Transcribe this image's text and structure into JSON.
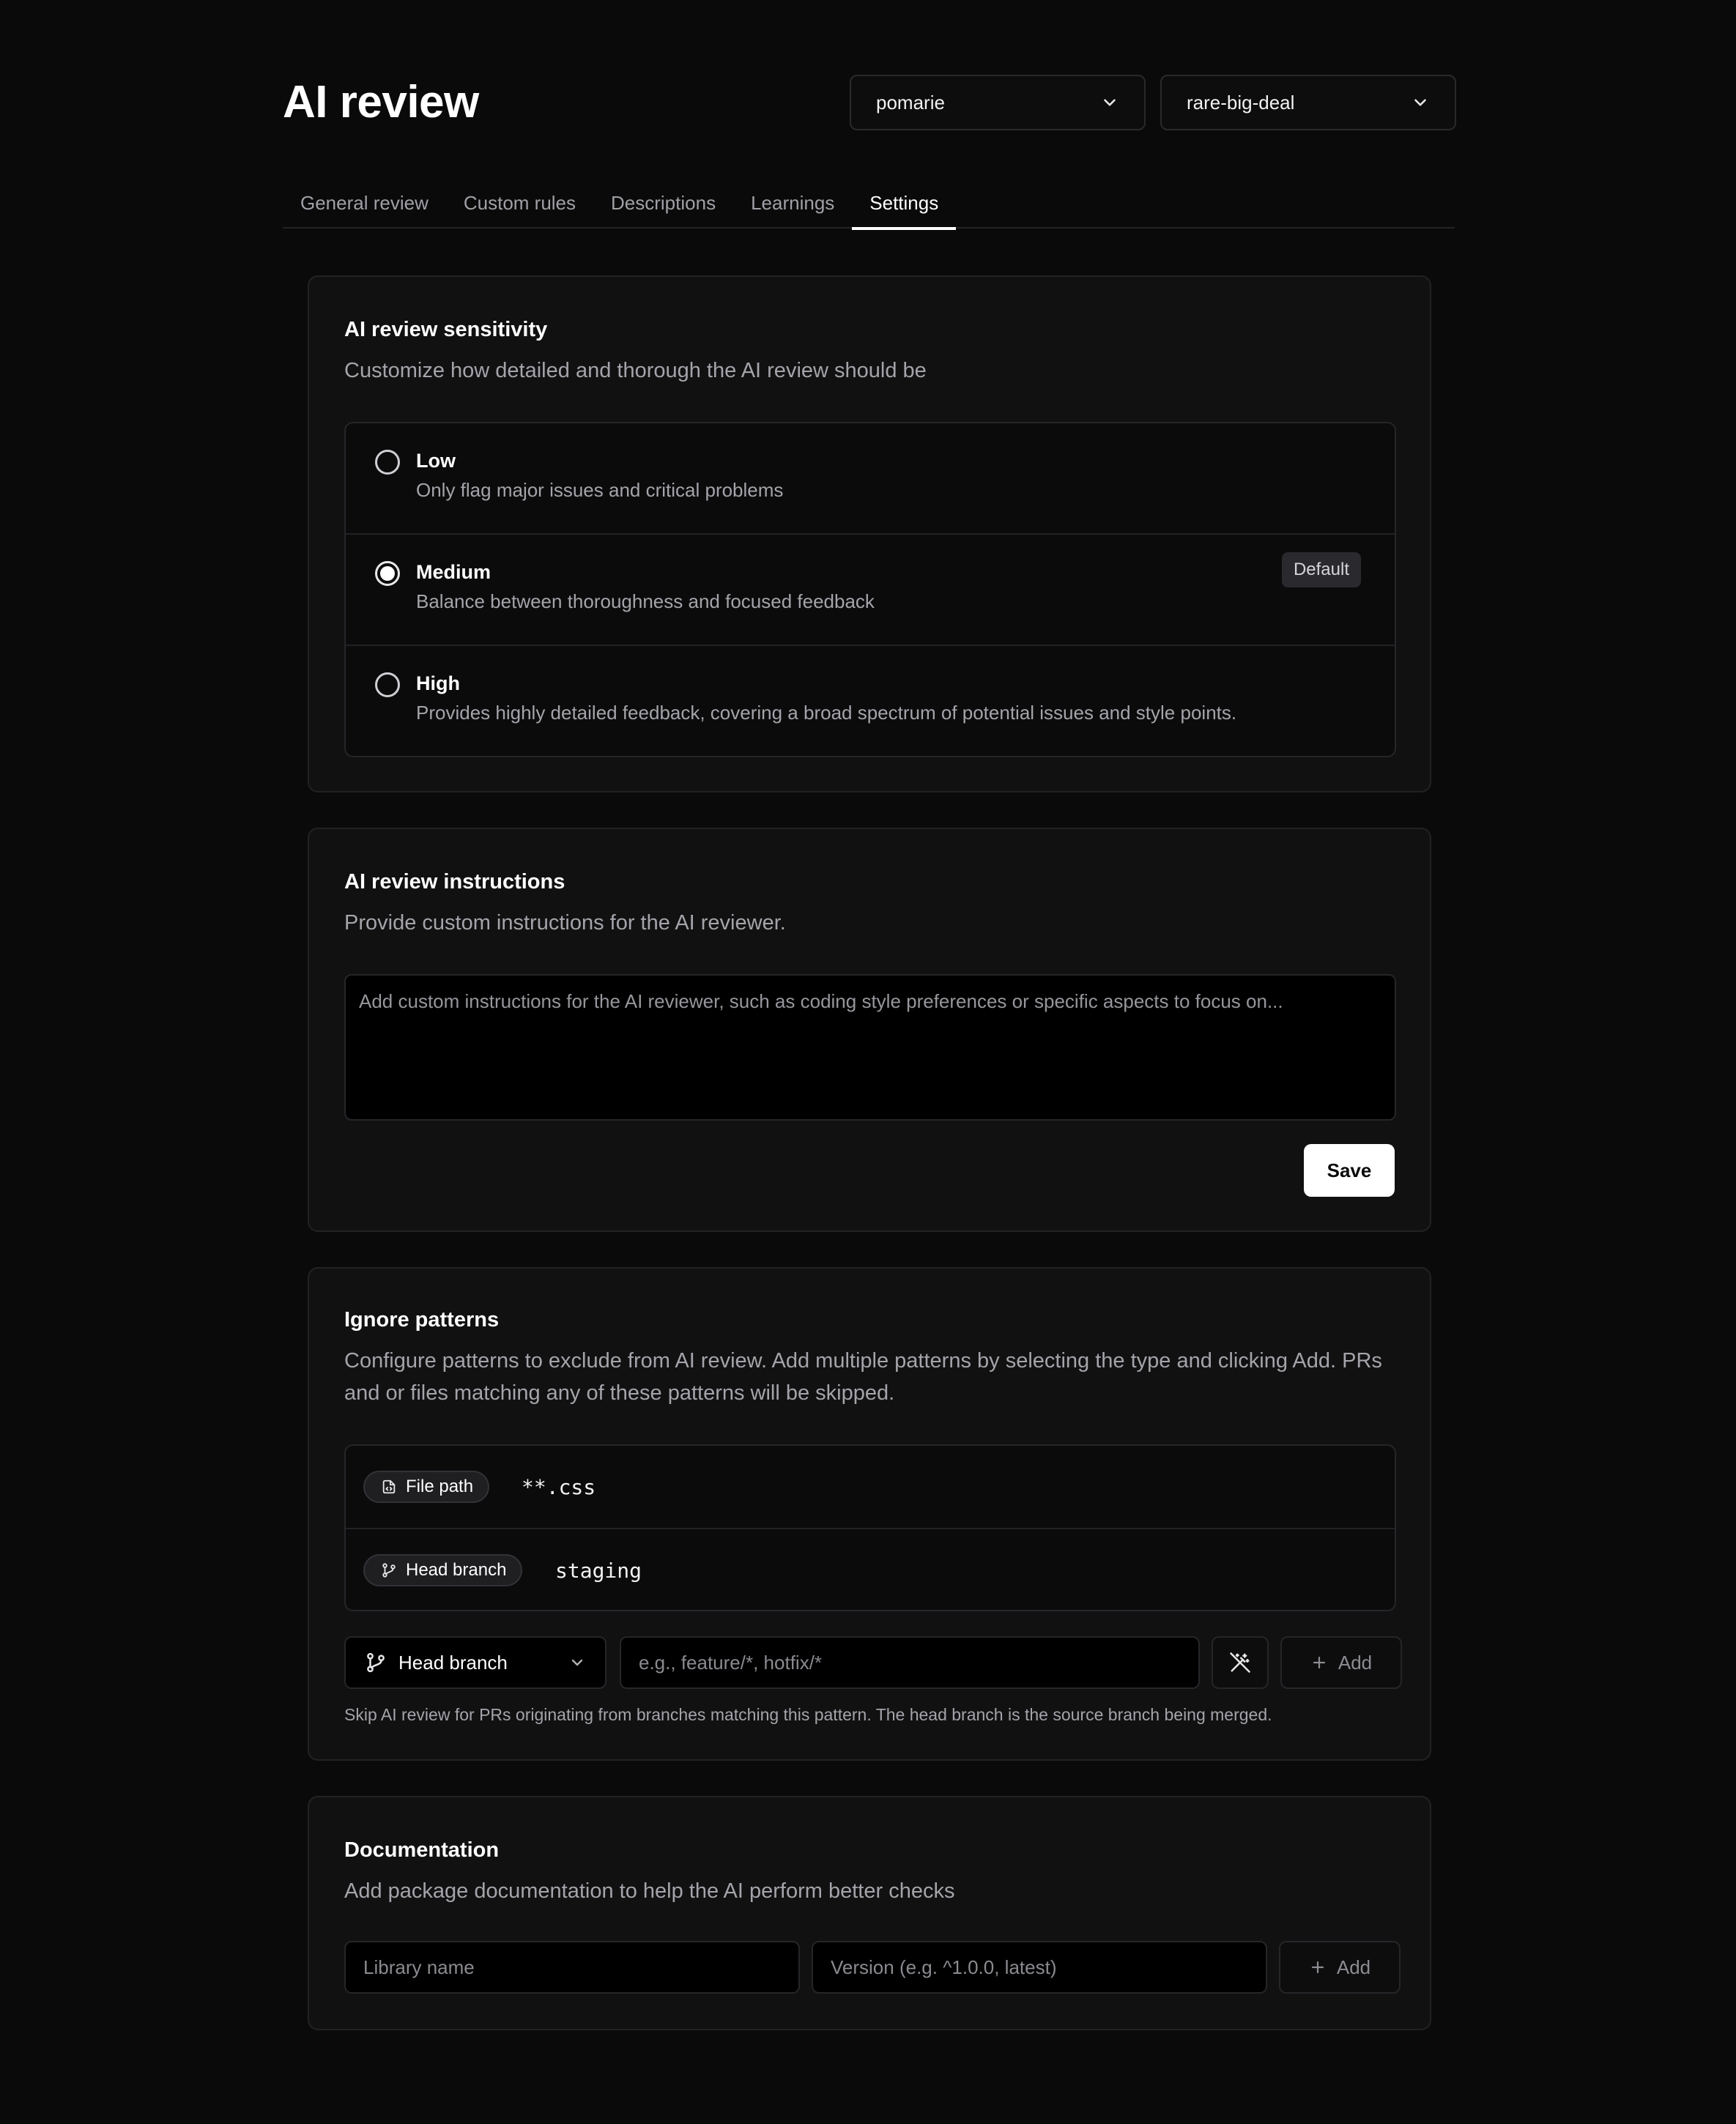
{
  "page": {
    "title": "AI review"
  },
  "selectors": {
    "org": {
      "value": "pomarie",
      "icon": "chevron-down-icon"
    },
    "repo": {
      "value": "rare-big-deal",
      "icon": "chevron-down-icon"
    }
  },
  "tabs": [
    {
      "label": "General review",
      "active": false
    },
    {
      "label": "Custom rules",
      "active": false
    },
    {
      "label": "Descriptions",
      "active": false
    },
    {
      "label": "Learnings",
      "active": false
    },
    {
      "label": "Settings",
      "active": true
    }
  ],
  "sensitivity": {
    "title": "AI review sensitivity",
    "description": "Customize how detailed and thorough the AI review should be",
    "options": [
      {
        "label": "Low",
        "description": "Only flag major issues and critical problems",
        "selected": false
      },
      {
        "label": "Medium",
        "description": "Balance between thoroughness and focused feedback",
        "selected": true,
        "badge": "Default"
      },
      {
        "label": "High",
        "description": "Provides highly detailed feedback, covering a broad spectrum of potential issues and style points.",
        "selected": false
      }
    ]
  },
  "instructions": {
    "title": "AI review instructions",
    "description": "Provide custom instructions for the AI reviewer.",
    "placeholder": "Add custom instructions for the AI reviewer, such as coding style preferences or specific aspects to focus on...",
    "value": "",
    "save_label": "Save"
  },
  "ignore": {
    "title": "Ignore patterns",
    "description": "Configure patterns to exclude from AI review. Add multiple patterns by selecting the type and clicking Add. PRs and or files matching any of these patterns will be skipped.",
    "patterns": [
      {
        "type": "File path",
        "icon": "file-icon",
        "value": "**.css"
      },
      {
        "type": "Head branch",
        "icon": "git-branch-icon",
        "value": "staging"
      }
    ],
    "type_select": {
      "value": "Head branch",
      "icon": "git-branch-icon"
    },
    "input_placeholder": "e.g., feature/*, hotfix/*",
    "magic_icon": "magic-wand-icon",
    "add_label": "Add",
    "hint": "Skip AI review for PRs originating from branches matching this pattern. The head branch is the source branch being merged."
  },
  "documentation": {
    "title": "Documentation",
    "description": "Add package documentation to help the AI perform better checks",
    "library_placeholder": "Library name",
    "version_placeholder": "Version (e.g. ^1.0.0, latest)",
    "add_label": "Add"
  },
  "colors": {
    "background": "#0a0a0b",
    "card": "#111112",
    "border": "#26262a",
    "text": "#f2f2f3",
    "muted": "#a4a4aa",
    "accent": "#ffffff"
  }
}
